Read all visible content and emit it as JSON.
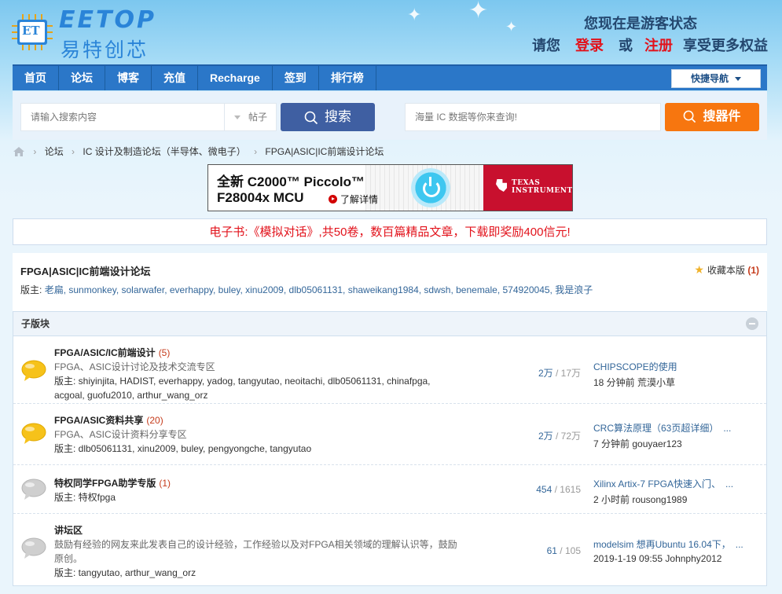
{
  "header": {
    "logo_en": "EETOP",
    "logo_cn": "易特创芯",
    "logo_chip_text": "ET",
    "guest_status": "您现在是游客状态",
    "login_prefix": "请您",
    "login_label": "登录",
    "or_label": "或",
    "register_label": "注册",
    "login_suffix": "享受更多权益"
  },
  "nav": {
    "items": [
      "首页",
      "论坛",
      "博客",
      "充值",
      "Recharge",
      "签到",
      "排行榜"
    ],
    "quick_nav": "快捷导航"
  },
  "search": {
    "placeholder": "请输入搜索内容",
    "type": "帖子",
    "button": "搜索",
    "ic_placeholder": "海量 IC 数据等你来查询!",
    "ic_button": "搜器件"
  },
  "breadcrumb": [
    "论坛",
    "IC 设计及制造论坛（半导体、微电子）",
    "FPGA|ASIC|IC前端设计论坛"
  ],
  "banner": {
    "line1": "全新 C2000™ Piccolo™",
    "line2": "F28004x MCU",
    "learn_more": "了解详情",
    "brand_line1": "TEXAS",
    "brand_line2": "INSTRUMENTS"
  },
  "notice": "电子书:《模拟对话》,共50卷，数百篇精品文章，下载即奖励400信元!",
  "forum": {
    "title": "FPGA|ASIC|IC前端设计论坛",
    "favorite_label": "收藏本版",
    "favorite_count": "(1)",
    "moderators_label": "版主:",
    "moderators": "老扁, sunmonkey, solarwafer, everhappy, buley, xinu2009, dlb05061131, shaweikang1984, sdwsh, benemale, 574920045, 我是浪子"
  },
  "subforums": {
    "header": "子版块",
    "rows": [
      {
        "name": "FPGA/ASIC/IC前端设计",
        "count": "(5)",
        "desc": "FPGA、ASIC设计讨论及技术交流专区",
        "mods": "版主: shiyinjita, HADIST, everhappy, yadog, tangyutao, neoitachi, dlb05061131, chinafpga, acgoal, guofu2010, arthur_wang_orz",
        "topics": "2万",
        "posts": "17万",
        "last_title": "CHIPSCOPE的使用",
        "last_meta": "18 分钟前 荒漠小草",
        "active": true
      },
      {
        "name": "FPGA/ASIC资料共享",
        "count": "(20)",
        "desc": "FPGA、ASIC设计资料分享专区",
        "mods": "版主: dlb05061131, xinu2009, buley, pengyongche, tangyutao",
        "topics": "2万",
        "posts": "72万",
        "last_title": "CRC算法原理（63页超详细）　...",
        "last_meta": "7 分钟前 gouyaer123",
        "active": true
      },
      {
        "name": "特权同学FPGA助学专版",
        "count": "(1)",
        "desc": "",
        "mods": "版主: 特权fpga",
        "topics": "454",
        "posts": "1615",
        "last_title": "Xilinx Artix-7 FPGA快速入门、　...",
        "last_meta": "2 小时前 rousong1989",
        "active": false
      },
      {
        "name": "讲坛区",
        "count": "",
        "desc": "鼓励有经验的网友来此发表自己的设计经验，工作经验以及对FPGA相关领域的理解认识等，鼓励原创。",
        "mods": "版主: tangyutao, arthur_wang_orz",
        "topics": "61",
        "posts": "105",
        "last_title": "modelsim 想再Ubuntu 16.04下，　...",
        "last_meta": "2019-1-19 09:55 Johnphy2012",
        "active": false
      }
    ]
  },
  "colors": {
    "nav_bg": "#2b77c8",
    "search_btn": "#3f5fa2",
    "ic_btn": "#f7760f",
    "accent_red": "#e2121b",
    "ti_red": "#c8102e",
    "bubble_active": "#f6c21a",
    "bubble_inactive": "#c8c8c8"
  },
  "icons": [
    "home-icon",
    "search-icon",
    "star-icon",
    "collapse-icon",
    "bubble-icon",
    "chevron-down-icon",
    "play-icon",
    "power-icon",
    "ti-logo-icon"
  ]
}
